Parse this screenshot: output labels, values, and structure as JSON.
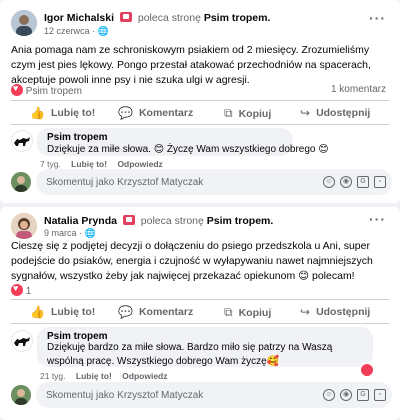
{
  "post1": {
    "author": "Igor Michalski",
    "action": "poleca stronę",
    "page": "Psim tropem",
    "date": "12 czerwca",
    "text": "Ania pomaga nam ze schroniskowym psiakiem od 2 miesięcy. Zrozumieliśmy czym jest pies lękowy. Pongo przestał atakować przechodniów na spacerach, akceptuje powoli inne psy i nie szuka ulgi w agresji.",
    "reactions_label": "Psim tropem",
    "comments_count": "1 komentarz",
    "comment": {
      "name": "Psim tropem",
      "text": "Dziękuje za miłe słowa. 😊 Życzę Wam wszystkiego dobrego 😊",
      "time": "7 tyg.",
      "like": "Lubię to!",
      "reply": "Odpowiedz"
    },
    "composer_placeholder": "Skomentuj jako Krzysztof Matyczak"
  },
  "post2": {
    "author": "Natalia Prynda",
    "action": "poleca stronę",
    "page": "Psim tropem",
    "date": "9 marca",
    "text": "Cieszę się z podjętej decyzji o dołączeniu do psiego przedszkola u Ani, super podejście do psiaków, energia i czujność w wyłapywaniu nawet najmniejszych sygnałów, wszystko żeby jak najwięcej przekazać opiekunom 😊 polecam!",
    "reactions_count": "1",
    "comment": {
      "name": "Psim tropem",
      "text": "Dziękuję bardzo za miłe słowa. Bardzo miło się patrzy na Waszą wspólną pracę. Wszystkiego dobrego Wam życzę🥰",
      "time": "21 tyg.",
      "like": "Lubię to!",
      "reply": "Odpowiedz"
    },
    "composer_placeholder": "Skomentuj jako Krzysztof Matyczak"
  },
  "actions": {
    "like": "Lubię to!",
    "comment": "Komentarz",
    "copy": "Kopiuj",
    "share": "Udostępnij"
  },
  "icons": {
    "more": "more-options-icon",
    "globe": "globe-icon",
    "like": "thumbs-up-icon",
    "comment": "comment-icon",
    "copy": "copy-icon",
    "share": "share-icon"
  },
  "colors": {
    "accent": "#1877f2",
    "recommend": "#e4405f",
    "heart": "#f33e58"
  }
}
